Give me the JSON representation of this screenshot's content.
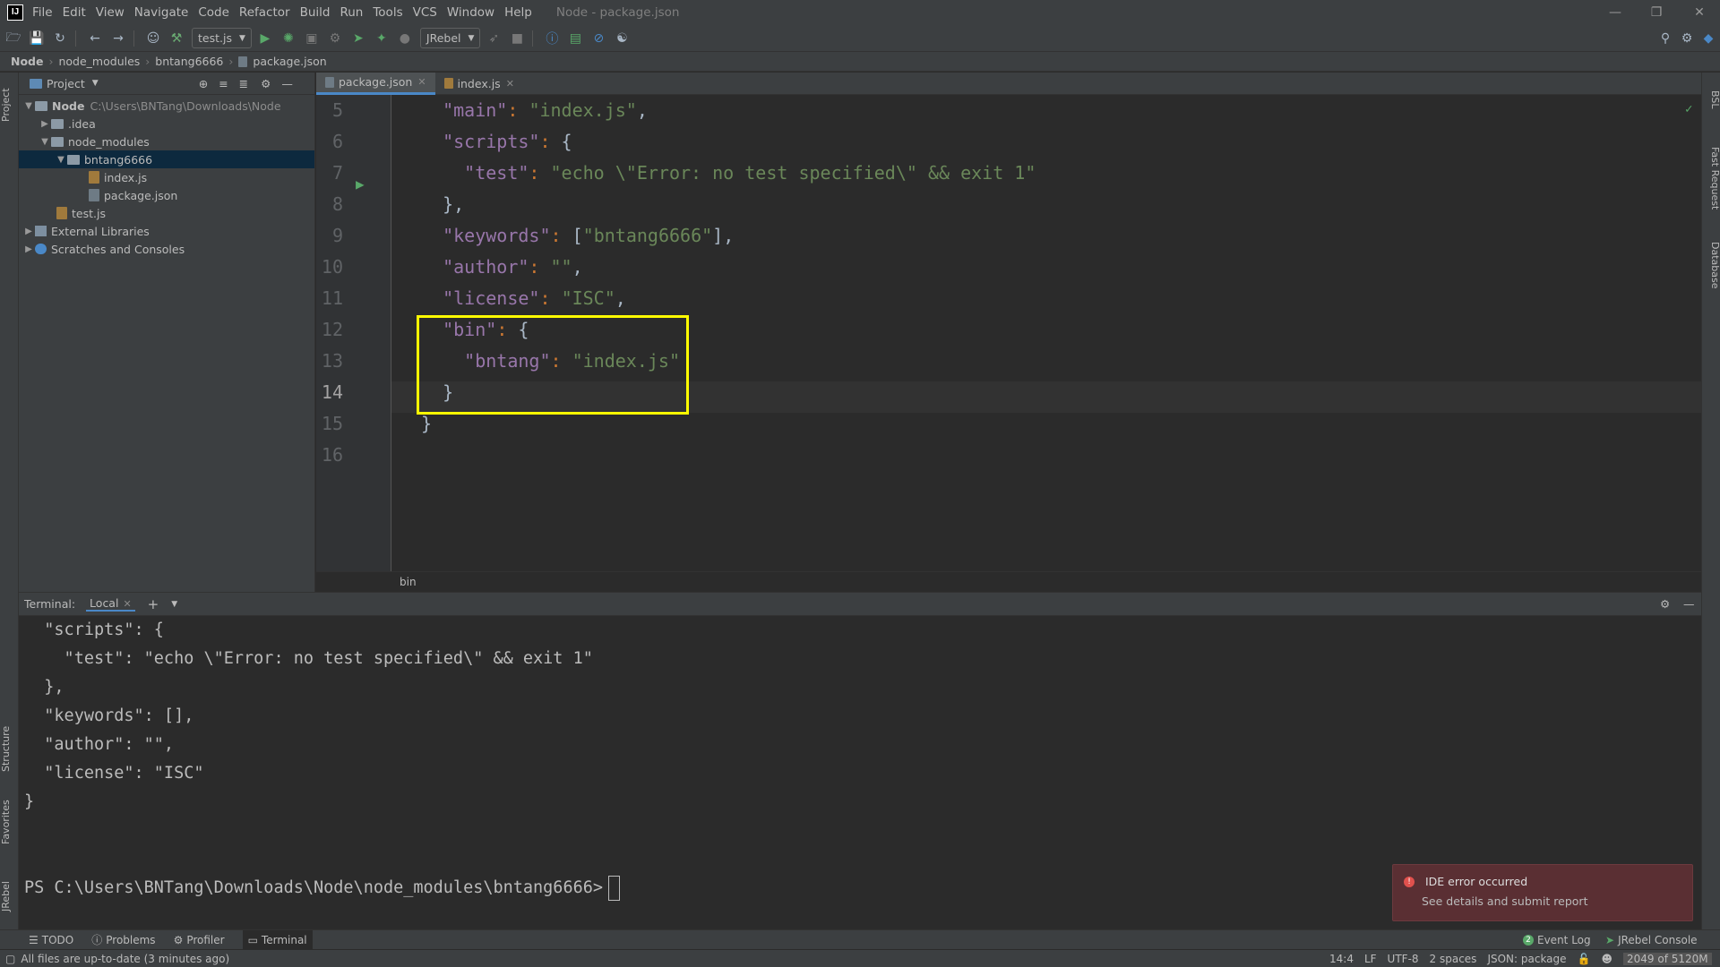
{
  "menubar": {
    "logo": "IJ",
    "items": [
      "File",
      "Edit",
      "View",
      "Navigate",
      "Code",
      "Refactor",
      "Build",
      "Run",
      "Tools",
      "VCS",
      "Window",
      "Help"
    ],
    "window_title": "Node - package.json"
  },
  "toolbar": {
    "run_config": "test.js",
    "jrebel_config": "JRebel"
  },
  "breadcrumb": [
    "Node",
    "node_modules",
    "bntang6666",
    "package.json"
  ],
  "left_strip": {
    "project": "Project",
    "structure": "Structure",
    "favorites": "Favorites",
    "jrebel": "JRebel"
  },
  "right_strip": {
    "bsl": "BSL",
    "fast_request": "Fast Request",
    "database": "Database"
  },
  "project": {
    "header": "Project",
    "tree": [
      {
        "label": "Node",
        "path": "C:\\Users\\BNTang\\Downloads\\Node"
      },
      {
        "label": ".idea"
      },
      {
        "label": "node_modules"
      },
      {
        "label": "bntang6666"
      },
      {
        "label": "index.js"
      },
      {
        "label": "package.json"
      },
      {
        "label": "test.js"
      },
      {
        "label": "External Libraries"
      },
      {
        "label": "Scratches and Consoles"
      }
    ]
  },
  "editor": {
    "tabs": [
      {
        "label": "package.json",
        "active": true
      },
      {
        "label": "index.js",
        "active": false
      }
    ],
    "lines": [
      {
        "n": "5",
        "t": "  \"main\": \"index.js\","
      },
      {
        "n": "6",
        "t": "  \"scripts\": {"
      },
      {
        "n": "7",
        "t": "    \"test\": \"echo \\\"Error: no test specified\\\" && exit 1\""
      },
      {
        "n": "8",
        "t": "  },"
      },
      {
        "n": "9",
        "t": "  \"keywords\": [\"bntang6666\"],"
      },
      {
        "n": "10",
        "t": "  \"author\": \"\","
      },
      {
        "n": "11",
        "t": "  \"license\": \"ISC\","
      },
      {
        "n": "12",
        "t": "  \"bin\": {"
      },
      {
        "n": "13",
        "t": "    \"bntang\": \"index.js\""
      },
      {
        "n": "14",
        "t": "  }"
      },
      {
        "n": "15",
        "t": "}"
      },
      {
        "n": "16",
        "t": ""
      }
    ],
    "footer_crumb": "bin"
  },
  "terminal": {
    "label": "Terminal:",
    "tab": "Local",
    "lines": [
      "  \"scripts\": {",
      "    \"test\": \"echo \\\"Error: no test specified\\\" && exit 1\"",
      "  },",
      "  \"keywords\": [],",
      "  \"author\": \"\",",
      "  \"license\": \"ISC\"",
      "}"
    ],
    "prompt": "PS C:\\Users\\BNTang\\Downloads\\Node\\node_modules\\bntang6666>"
  },
  "notification": {
    "title": "IDE error occurred",
    "link": "See details and submit report",
    "color": "#5a2f33"
  },
  "bottom_tools": {
    "todo": "TODO",
    "problems": "Problems",
    "profiler": "Profiler",
    "terminal": "Terminal",
    "event_log_count": "2",
    "event_log": "Event Log",
    "jrebel_console": "JRebel Console"
  },
  "status": {
    "message": "All files are up-to-date (3 minutes ago)",
    "position": "14:4",
    "line_sep": "LF",
    "encoding": "UTF-8",
    "indent": "2 spaces",
    "schema": "JSON: package",
    "memory": "2049 of 5120M"
  },
  "colors": {
    "highlight_box": "#fffb00",
    "selection": "#0d293e",
    "accent": "#4a88c7"
  }
}
